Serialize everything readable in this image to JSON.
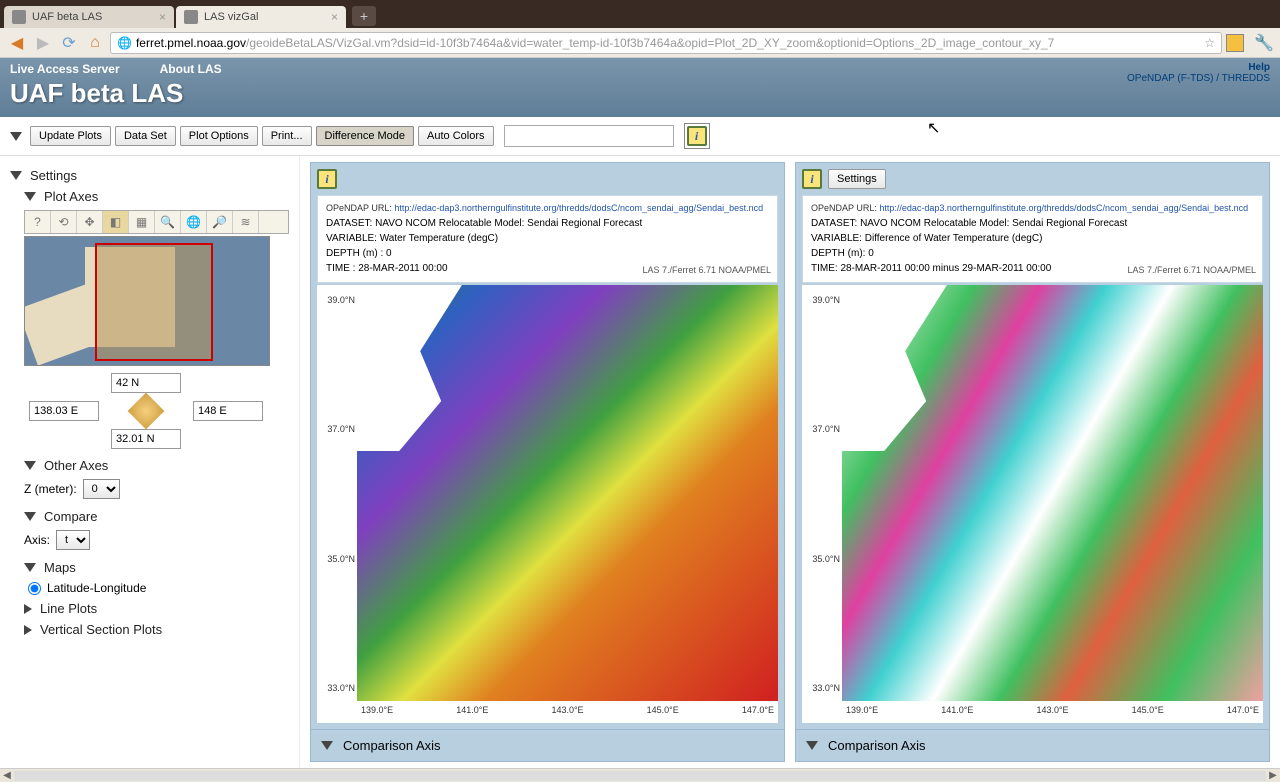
{
  "browser": {
    "tabs": [
      {
        "title": "UAF beta LAS",
        "active": false
      },
      {
        "title": "LAS vizGal",
        "active": true
      }
    ],
    "url_domain": "ferret.pmel.noaa.gov",
    "url_path": "/geoideBetaLAS/VizGal.vm?dsid=id-10f3b7464a&vid=water_temp-id-10f3b7464a&opid=Plot_2D_XY_zoom&optionid=Options_2D_image_contour_xy_7"
  },
  "header": {
    "link1": "Live Access Server",
    "link2": "About LAS",
    "title": "UAF beta LAS",
    "help": "Help",
    "right_links": "OPeNDAP (F-TDS) / THREDDS"
  },
  "toolbar": {
    "update": "Update Plots",
    "dataset": "Data Set",
    "plotopts": "Plot Options",
    "print": "Print...",
    "diffmode": "Difference Mode",
    "autocolors": "Auto Colors"
  },
  "sidebar": {
    "settings": "Settings",
    "plotaxes": "Plot Axes",
    "coords": {
      "north": "42 N",
      "south": "32.01 N",
      "west": "138.03 E",
      "east": "148 E"
    },
    "otheraxes": "Other Axes",
    "z_label": "Z (meter):",
    "z_value": "0",
    "compare": "Compare",
    "axis_label": "Axis:",
    "axis_value": "t",
    "maps": "Maps",
    "maps_option": "Latitude-Longitude",
    "lineplots": "Line Plots",
    "vertsection": "Vertical Section Plots"
  },
  "panel1": {
    "opendap_label": "OPeNDAP URL:",
    "opendap_url": "http://edac-dap3.northerngulfinstitute.org/thredds/dodsC/ncom_sendai_agg/Sendai_best.ncd",
    "dataset": "DATASET: NAVO NCOM Relocatable Model: Sendai Regional Forecast",
    "variable": "VARIABLE: Water Temperature (degC)",
    "depth": "DEPTH (m) : 0",
    "time": "TIME : 28-MAR-2011 00:00",
    "credit": "LAS 7./Ferret 6.71 NOAA/PMEL",
    "yticks": [
      "39.0°N",
      "37.0°N",
      "35.0°N",
      "33.0°N"
    ],
    "xticks": [
      "139.0°E",
      "141.0°E",
      "143.0°E",
      "145.0°E",
      "147.0°E"
    ],
    "comparison": "Comparison Axis"
  },
  "panel2": {
    "settings_btn": "Settings",
    "opendap_label": "OPeNDAP URL:",
    "opendap_url": "http://edac-dap3.northerngulfinstitute.org/thredds/dodsC/ncom_sendai_agg/Sendai_best.ncd",
    "dataset": "DATASET: NAVO NCOM Relocatable Model: Sendai Regional Forecast",
    "variable": "VARIABLE: Difference of Water Temperature (degC)",
    "depth": "DEPTH (m): 0",
    "time": "TIME: 28-MAR-2011 00:00 minus 29-MAR-2011 00:00",
    "credit": "LAS 7./Ferret 6.71 NOAA/PMEL",
    "yticks": [
      "39.0°N",
      "37.0°N",
      "35.0°N",
      "33.0°N"
    ],
    "xticks": [
      "139.0°E",
      "141.0°E",
      "143.0°E",
      "145.0°E",
      "147.0°E"
    ],
    "comparison": "Comparison Axis"
  }
}
